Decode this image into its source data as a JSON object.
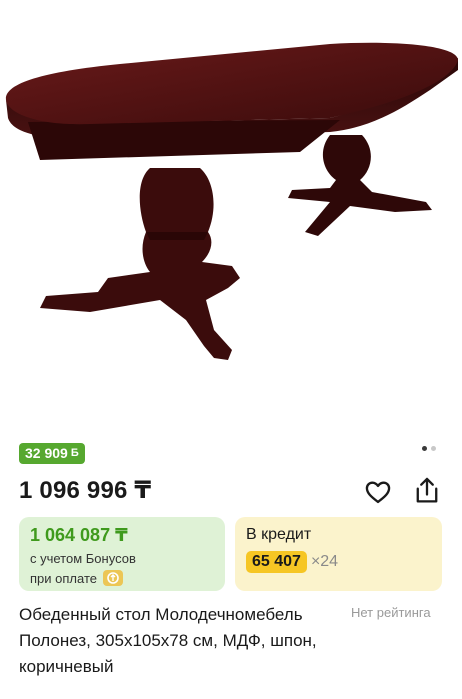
{
  "product": {
    "image_alt": "table-photo",
    "carousel": {
      "total": 2,
      "active": 0
    },
    "bonus_badge": "32 909",
    "bonus_coin_symbol": "Б",
    "price": "1 096 996 ₸",
    "bonus_card": {
      "price": "1 064 087 ₸",
      "note_line1": "с учетом Бонусов",
      "note_line2": "при оплате"
    },
    "credit_card": {
      "title": "В кредит",
      "amount": "65 407",
      "months": "×24"
    },
    "title": "Обеденный стол Молодечномебель Полонез, 305x105x78 см, МДФ, шпон, коричневый",
    "rating": "Нет рейтинга"
  },
  "colors": {
    "bonus_green": "#56a82f",
    "bonus_card_bg": "#dff2d6",
    "credit_card_bg": "#fbf3cc",
    "credit_chip": "#f6c624",
    "wood": "#3d0e0e"
  }
}
